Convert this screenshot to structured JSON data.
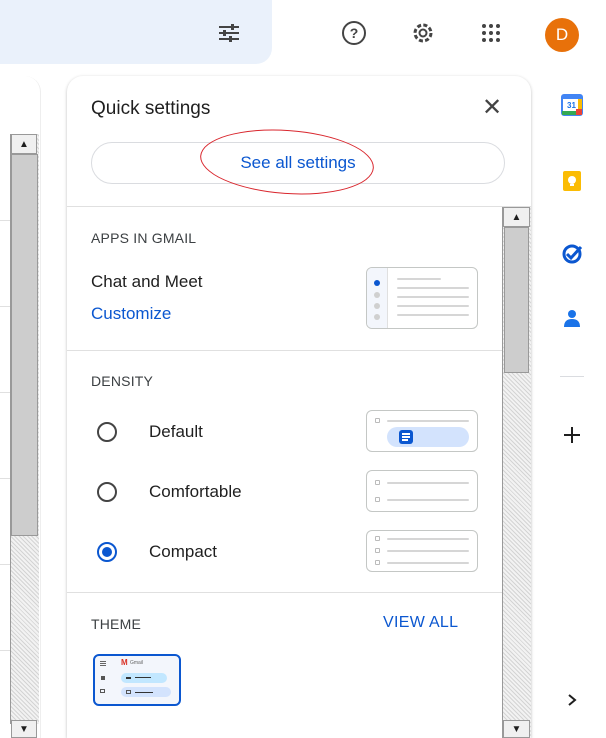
{
  "topbar": {
    "icons": [
      "tune-icon",
      "help-icon",
      "settings-icon",
      "apps-icon"
    ],
    "avatar_letter": "D",
    "avatar_color": "#e8710a"
  },
  "quick_settings": {
    "title": "Quick settings",
    "close_icon": "close-icon",
    "see_all_label": "See all settings",
    "apps_section": {
      "label": "APPS IN GMAIL",
      "item_title": "Chat and Meet",
      "customize_label": "Customize"
    },
    "density_section": {
      "label": "DENSITY",
      "options": [
        {
          "label": "Default",
          "selected": false
        },
        {
          "label": "Comfortable",
          "selected": false
        },
        {
          "label": "Compact",
          "selected": true
        }
      ]
    },
    "theme_section": {
      "label": "THEME",
      "view_all_label": "VIEW ALL",
      "thumb_logo_text": "Gmail"
    }
  },
  "side_panel": {
    "calendar_day": "31",
    "apps": [
      "calendar-icon",
      "keep-icon",
      "tasks-icon",
      "contacts-icon"
    ],
    "add_icon": "plus-icon",
    "expand_icon": "chevron-right-icon"
  },
  "colors": {
    "accent": "#0b57d0",
    "annotation": "#d9272e",
    "topbar_bg": "#eaf1fb"
  }
}
